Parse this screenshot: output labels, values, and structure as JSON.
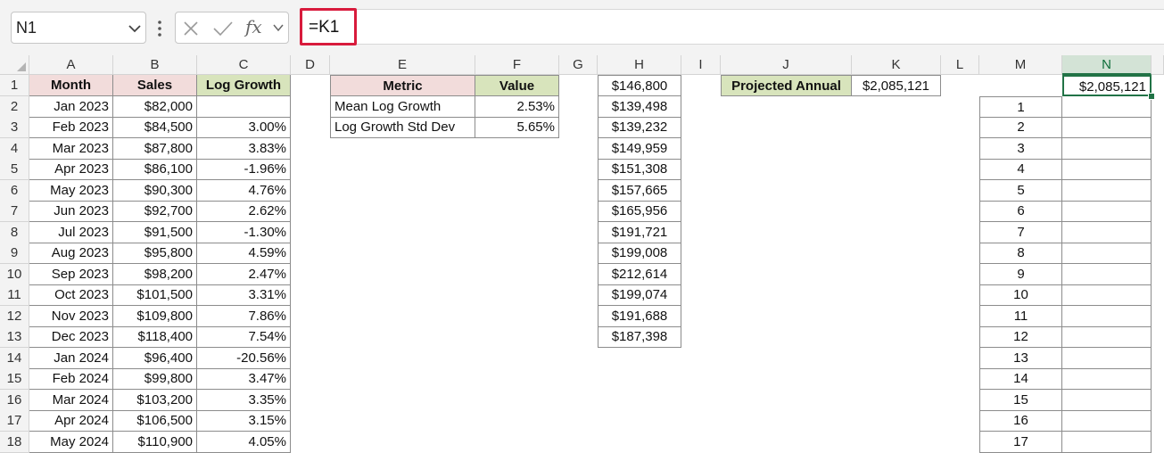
{
  "formula_bar": {
    "name_box": "N1",
    "formula": "=K1",
    "fx_label": "fx"
  },
  "columns": [
    "A",
    "B",
    "C",
    "D",
    "E",
    "F",
    "G",
    "H",
    "I",
    "J",
    "K",
    "L",
    "M",
    "N"
  ],
  "selected_column": "N",
  "rows": [
    "1",
    "2",
    "3",
    "4",
    "5",
    "6",
    "7",
    "8",
    "9",
    "10",
    "11",
    "12",
    "13",
    "14",
    "15",
    "16",
    "17",
    "18"
  ],
  "sales_table": {
    "headers": [
      "Month",
      "Sales",
      "Log Growth"
    ],
    "months": [
      "Jan 2023",
      "Feb 2023",
      "Mar 2023",
      "Apr 2023",
      "May 2023",
      "Jun 2023",
      "Jul 2023",
      "Aug 2023",
      "Sep 2023",
      "Oct 2023",
      "Nov 2023",
      "Dec 2023",
      "Jan 2024",
      "Feb 2024",
      "Mar 2024",
      "Apr 2024",
      "May 2024"
    ],
    "sales": [
      "$82,000",
      "$84,500",
      "$87,800",
      "$86,100",
      "$90,300",
      "$92,700",
      "$91,500",
      "$95,800",
      "$98,200",
      "$101,500",
      "$109,800",
      "$118,400",
      "$96,400",
      "$99,800",
      "$103,200",
      "$106,500",
      "$110,900"
    ],
    "log_growth": [
      "",
      "3.00%",
      "3.83%",
      "-1.96%",
      "4.76%",
      "2.62%",
      "-1.30%",
      "4.59%",
      "2.47%",
      "3.31%",
      "7.86%",
      "7.54%",
      "-20.56%",
      "3.47%",
      "3.35%",
      "3.15%",
      "4.05%"
    ]
  },
  "metrics_table": {
    "headers": [
      "Metric",
      "Value"
    ],
    "rows": [
      {
        "metric": "Mean Log Growth",
        "value": "2.53%"
      },
      {
        "metric": "Log Growth Std Dev",
        "value": "5.65%"
      }
    ]
  },
  "projection_column_h": [
    "$146,800",
    "$139,498",
    "$139,232",
    "$149,959",
    "$151,308",
    "$157,665",
    "$165,956",
    "$191,721",
    "$199,008",
    "$212,614",
    "$199,074",
    "$191,688",
    "$187,398"
  ],
  "projected_annual": {
    "label": "Projected Annual",
    "value": "$2,085,121"
  },
  "index_column_m": [
    "1",
    "2",
    "3",
    "4",
    "5",
    "6",
    "7",
    "8",
    "9",
    "10",
    "11",
    "12",
    "13",
    "14",
    "15",
    "16",
    "17"
  ],
  "selected_cell": {
    "ref": "N1",
    "value": "$2,085,121"
  },
  "colors": {
    "header_pink": "#f2dcdb",
    "header_green": "#d8e4bc",
    "selection_green": "#217346",
    "formula_highlight_red": "#d81b3c"
  }
}
